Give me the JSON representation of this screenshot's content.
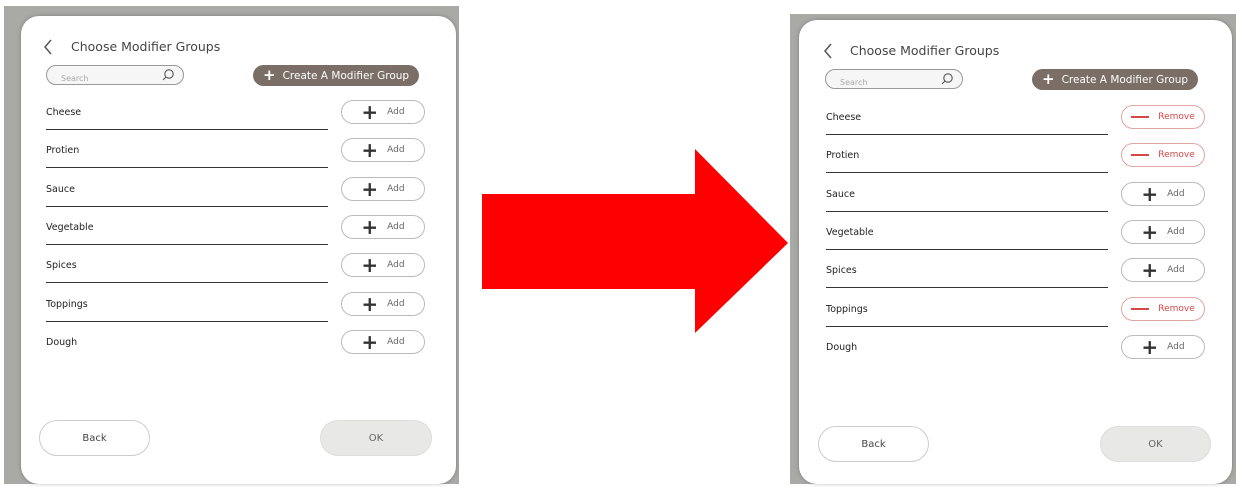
{
  "colors": {
    "accent": "#7a6e66",
    "remove": "#d14a4a",
    "arrow": "#ff0000",
    "backdrop": "#a9a9a6"
  },
  "before": {
    "title": "Choose Modifier Groups",
    "search_placeholder": "Search",
    "create_label": "Create A Modifier Group",
    "rows": [
      {
        "label": "Cheese",
        "action": "Add"
      },
      {
        "label": "Protien",
        "action": "Add"
      },
      {
        "label": "Sauce",
        "action": "Add"
      },
      {
        "label": "Vegetable",
        "action": "Add"
      },
      {
        "label": "Spices",
        "action": "Add"
      },
      {
        "label": "Toppings",
        "action": "Add"
      },
      {
        "label": "Dough",
        "action": "Add"
      }
    ],
    "back_label": "Back",
    "ok_label": "OK"
  },
  "after": {
    "title": "Choose Modifier Groups",
    "search_placeholder": "Search",
    "create_label": "Create A Modifier Group",
    "rows": [
      {
        "label": "Cheese",
        "action": "Remove"
      },
      {
        "label": "Protien",
        "action": "Remove"
      },
      {
        "label": "Sauce",
        "action": "Add"
      },
      {
        "label": "Vegetable",
        "action": "Add"
      },
      {
        "label": "Spices",
        "action": "Add"
      },
      {
        "label": "Toppings",
        "action": "Remove"
      },
      {
        "label": "Dough",
        "action": "Add"
      }
    ],
    "back_label": "Back",
    "ok_label": "OK"
  }
}
